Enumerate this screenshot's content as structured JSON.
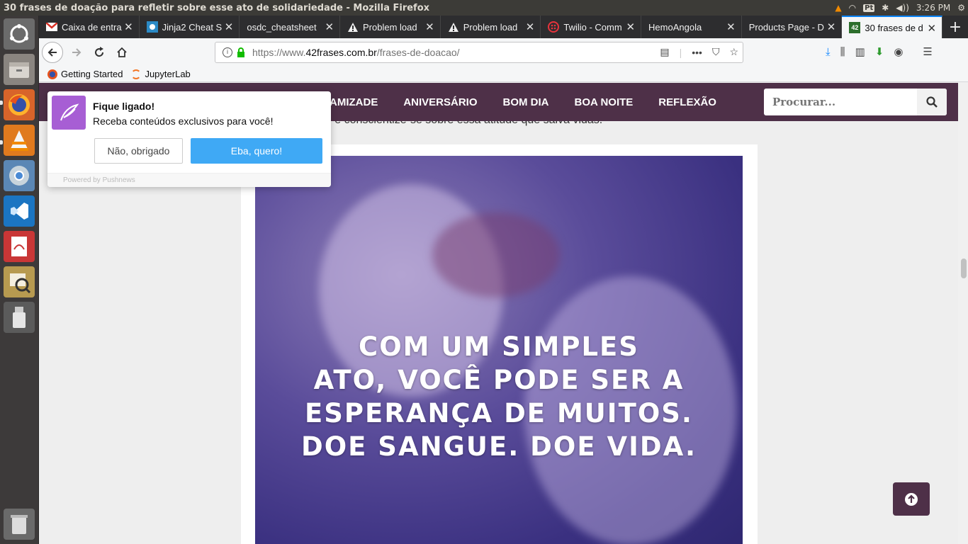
{
  "os": {
    "window_title": "30 frases de doação para refletir sobre esse ato de solidariedade - Mozilla Firefox",
    "keyboard_layout": "Pt",
    "clock": "3:26 PM",
    "launcher_apps": [
      "ubuntu-dash-icon",
      "files-icon",
      "firefox-icon",
      "vlc-icon",
      "chrome-icon",
      "vscode-icon",
      "document-viewer-icon",
      "image-viewer-icon",
      "usb-drive-icon",
      "trash-icon"
    ]
  },
  "browser": {
    "tabs": [
      {
        "label": "Caixa de entra",
        "icon": "gmail-icon",
        "active": false
      },
      {
        "label": "Jinja2 Cheat S",
        "icon": "jinja-icon",
        "active": false
      },
      {
        "label": "osdc_cheatsheet",
        "icon": "none",
        "active": false
      },
      {
        "label": "Problem load",
        "icon": "warning-icon",
        "active": false
      },
      {
        "label": "Problem load",
        "icon": "warning-icon",
        "active": false
      },
      {
        "label": "Twilio - Comm",
        "icon": "twilio-icon",
        "active": false
      },
      {
        "label": "HemoAngola",
        "icon": "none",
        "active": false
      },
      {
        "label": "Products Page - D",
        "icon": "none",
        "active": false
      },
      {
        "label": "30 frases de d",
        "icon": "site-42-icon",
        "active": true
      }
    ],
    "url_base": "https://www.",
    "url_domain": "42frases.com.br",
    "url_path": "/frases-de-doacao/",
    "bookmarks": [
      {
        "label": "Getting Started",
        "icon": "firefox-icon"
      },
      {
        "label": "JupyterLab",
        "icon": "jupyter-icon"
      }
    ]
  },
  "site": {
    "menu": [
      "AMIZADE",
      "ANIVERSÁRIO",
      "BOM DIA",
      "BOA NOITE",
      "REFLEXÃO"
    ],
    "search_placeholder": "Procurar...",
    "intro_fragment": "de e conscientize-se sobre essa atitude que salva vidas.",
    "hero_quote": [
      "COM UM SIMPLES",
      "ATO, VOCÊ PODE SER A",
      "ESPERANÇA DE MUITOS.",
      "DOE SANGUE. DOE VIDA."
    ],
    "brand_color": "#4e3048"
  },
  "popup": {
    "title": "Fique ligado!",
    "text": "Receba conteúdos exclusivos para você!",
    "no_label": "Não, obrigado",
    "yes_label": "Eba, quero!",
    "powered": "Powered by Pushnews",
    "accent": "#3fa9f5"
  }
}
